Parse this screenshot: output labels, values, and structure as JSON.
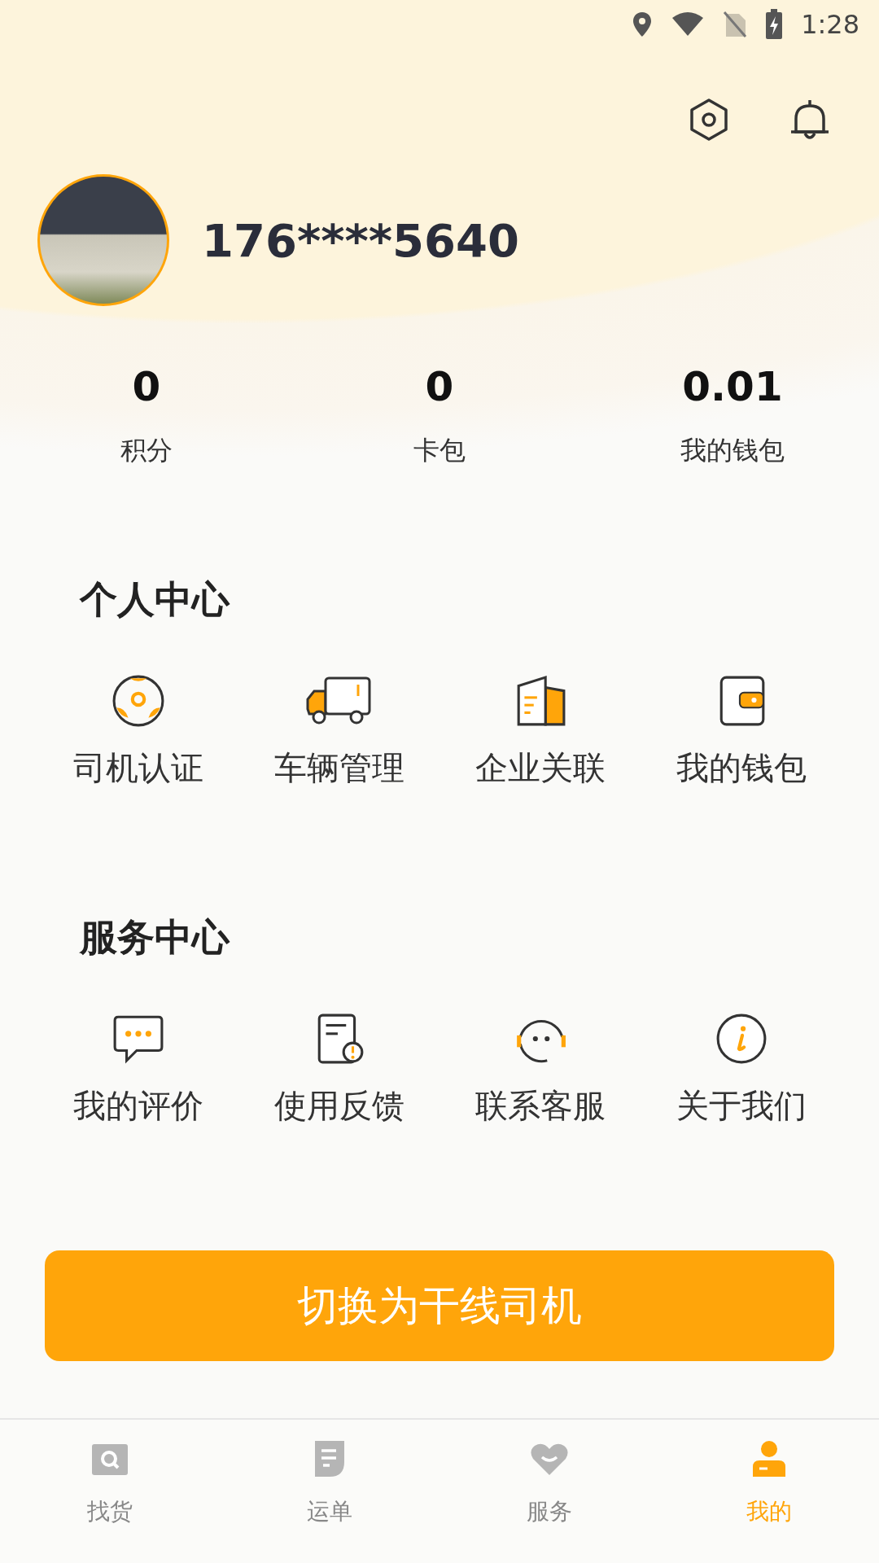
{
  "status_bar": {
    "time": "1:28"
  },
  "profile": {
    "phone": "176****5640"
  },
  "stats": [
    {
      "value": "0",
      "label": "积分"
    },
    {
      "value": "0",
      "label": "卡包"
    },
    {
      "value": "0.01",
      "label": "我的钱包"
    }
  ],
  "sections": [
    {
      "title": "个人中心",
      "items": [
        {
          "label": "司机认证"
        },
        {
          "label": "车辆管理"
        },
        {
          "label": "企业关联"
        },
        {
          "label": "我的钱包"
        }
      ]
    },
    {
      "title": "服务中心",
      "items": [
        {
          "label": "我的评价"
        },
        {
          "label": "使用反馈"
        },
        {
          "label": "联系客服"
        },
        {
          "label": "关于我们"
        }
      ]
    }
  ],
  "switch_button": {
    "label": "切换为干线司机"
  },
  "bottom_nav": [
    {
      "label": "找货",
      "selected": false
    },
    {
      "label": "运单",
      "selected": false
    },
    {
      "label": "服务",
      "selected": false
    },
    {
      "label": "我的",
      "selected": true
    }
  ]
}
